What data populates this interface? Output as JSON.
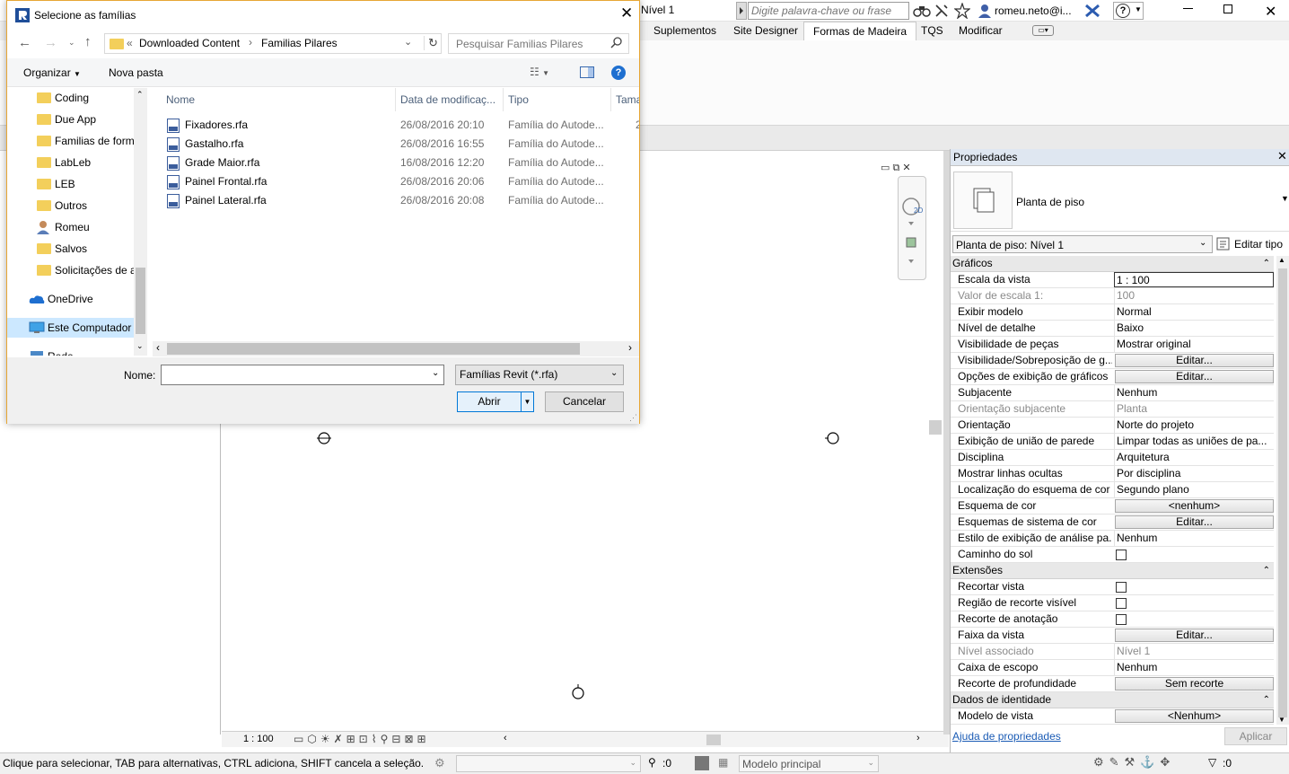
{
  "titlebar": {
    "view_title": "Nível 1",
    "search_placeholder": "Digite palavra-chave ou frase",
    "user": "romeu.neto@i...",
    "help": "?"
  },
  "ribbon": {
    "tabs": [
      "Suplementos",
      "Site Designer",
      "Formas de Madeira",
      "TQS",
      "Modificar"
    ],
    "active_tab": "Formas de Madeira"
  },
  "dialog": {
    "title": "Selecione as famílias",
    "breadcrumb": [
      "Downloaded Content",
      "Familias Pilares"
    ],
    "search_placeholder": "Pesquisar Familias Pilares",
    "toolbar": {
      "organize": "Organizar",
      "new_folder": "Nova pasta",
      "help": "?"
    },
    "tree": [
      {
        "label": "Coding",
        "icon": "folder-icon"
      },
      {
        "label": "Due App",
        "icon": "folder-icon"
      },
      {
        "label": "Familias de form",
        "icon": "folder-icon"
      },
      {
        "label": "LabLeb",
        "icon": "folder-icon"
      },
      {
        "label": "LEB",
        "icon": "folder-icon"
      },
      {
        "label": "Outros",
        "icon": "folder-icon"
      },
      {
        "label": "Romeu",
        "icon": "user-folder-icon"
      },
      {
        "label": "Salvos",
        "icon": "folder-icon"
      },
      {
        "label": "Solicitações de a",
        "icon": "folder-icon"
      },
      {
        "label": "OneDrive",
        "icon": "onedrive-icon"
      },
      {
        "label": "Este Computador",
        "icon": "computer-icon"
      },
      {
        "label": "Rede",
        "icon": "network-icon"
      }
    ],
    "columns": [
      "Nome",
      "Data de modificaç...",
      "Tipo",
      "Tama"
    ],
    "files": [
      {
        "name": "Fixadores.rfa",
        "date": "26/08/2016 20:10",
        "type": "Família do Autode...",
        "size": "2"
      },
      {
        "name": "Gastalho.rfa",
        "date": "26/08/2016 16:55",
        "type": "Família do Autode..."
      },
      {
        "name": "Grade Maior.rfa",
        "date": "16/08/2016 12:20",
        "type": "Família do Autode..."
      },
      {
        "name": "Painel Frontal.rfa",
        "date": "26/08/2016 20:06",
        "type": "Família do Autode..."
      },
      {
        "name": "Painel Lateral.rfa",
        "date": "26/08/2016 20:08",
        "type": "Família do Autode..."
      }
    ],
    "name_label": "Nome:",
    "name_value": "",
    "filter": "Famílias Revit (*.rfa)",
    "open_button": "Abrir",
    "cancel_button": "Cancelar"
  },
  "view": {
    "scale": "1 : 100"
  },
  "properties": {
    "title": "Propriedades",
    "type_name": "Planta de piso",
    "selector": "Planta de piso: Nível 1",
    "edit_type": "Editar tipo",
    "groups": [
      {
        "name": "Gráficos",
        "rows": [
          {
            "name": "Escala da vista",
            "value": "1 : 100",
            "kind": "input"
          },
          {
            "name": "Valor de escala    1:",
            "value": "100",
            "kind": "text",
            "disabled": true
          },
          {
            "name": "Exibir modelo",
            "value": "Normal",
            "kind": "text"
          },
          {
            "name": "Nível de detalhe",
            "value": "Baixo",
            "kind": "text"
          },
          {
            "name": "Visibilidade de peças",
            "value": "Mostrar original",
            "kind": "text"
          },
          {
            "name": "Visibilidade/Sobreposição de g...",
            "value": "Editar...",
            "kind": "button"
          },
          {
            "name": "Opções de exibição de gráficos",
            "value": "Editar...",
            "kind": "button"
          },
          {
            "name": "Subjacente",
            "value": "Nenhum",
            "kind": "text"
          },
          {
            "name": "Orientação subjacente",
            "value": "Planta",
            "kind": "text",
            "disabled": true
          },
          {
            "name": "Orientação",
            "value": "Norte do projeto",
            "kind": "text"
          },
          {
            "name": "Exibição de união de parede",
            "value": "Limpar todas as uniões de pa...",
            "kind": "text"
          },
          {
            "name": "Disciplina",
            "value": "Arquitetura",
            "kind": "text"
          },
          {
            "name": "Mostrar linhas ocultas",
            "value": "Por disciplina",
            "kind": "text"
          },
          {
            "name": "Localização do esquema de cor",
            "value": "Segundo plano",
            "kind": "text"
          },
          {
            "name": "Esquema de cor",
            "value": "<nenhum>",
            "kind": "button"
          },
          {
            "name": "Esquemas de sistema de cor",
            "value": "Editar...",
            "kind": "button"
          },
          {
            "name": "Estilo de exibição de análise pa...",
            "value": "Nenhum",
            "kind": "text"
          },
          {
            "name": "Caminho do sol",
            "value": "",
            "kind": "checkbox"
          }
        ]
      },
      {
        "name": "Extensões",
        "rows": [
          {
            "name": "Recortar vista",
            "value": "",
            "kind": "checkbox"
          },
          {
            "name": "Região de recorte visível",
            "value": "",
            "kind": "checkbox"
          },
          {
            "name": "Recorte de anotação",
            "value": "",
            "kind": "checkbox"
          },
          {
            "name": "Faixa da vista",
            "value": "Editar...",
            "kind": "button"
          },
          {
            "name": "Nível associado",
            "value": "Nível 1",
            "kind": "text",
            "disabled": true
          },
          {
            "name": "Caixa de escopo",
            "value": "Nenhum",
            "kind": "text"
          },
          {
            "name": "Recorte de profundidade",
            "value": "Sem recorte",
            "kind": "button"
          }
        ]
      },
      {
        "name": "Dados de identidade",
        "rows": [
          {
            "name": "Modelo de vista",
            "value": "<Nenhum>",
            "kind": "button"
          }
        ]
      }
    ],
    "help_link": "Ajuda de propriedades",
    "apply": "Aplicar"
  },
  "status": {
    "message": "Clique para selecionar, TAB para alternativas, CTRL adiciona, SHIFT cancela a seleção.",
    "count1": ":0",
    "model": "Modelo principal",
    "count2": ":0"
  }
}
